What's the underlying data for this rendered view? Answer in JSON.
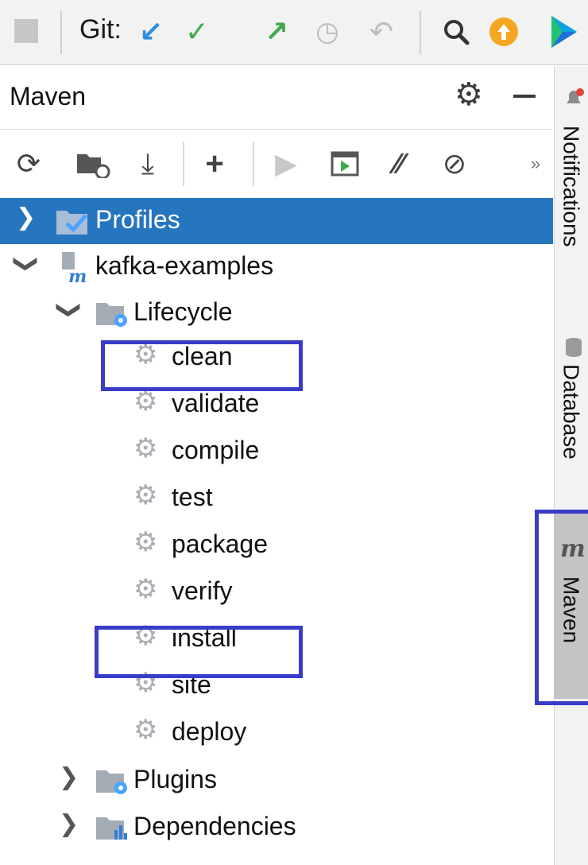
{
  "toolbar": {
    "git_label": "Git:",
    "icons": [
      "stop-icon",
      "update-project-icon",
      "commit-icon",
      "push-icon",
      "history-icon",
      "rollback-icon",
      "search-icon",
      "update-available-icon",
      "ide-logo-icon"
    ],
    "colors": {
      "update": "#2d8fe0",
      "commit": "#3fa84b",
      "push": "#3fa84b",
      "update_available": "#f5a623"
    }
  },
  "panel": {
    "title": "Maven",
    "toolbar_icons": [
      "reload-all-icon",
      "reload-folder-icon",
      "download-icon",
      "add-icon",
      "run-icon",
      "execute-goal-icon",
      "toggle-offline-icon",
      "skip-tests-icon",
      "more-icon"
    ]
  },
  "tree": {
    "profiles": "Profiles",
    "project": "kafka-examples",
    "lifecycle": "Lifecycle",
    "goals": [
      "clean",
      "validate",
      "compile",
      "test",
      "package",
      "verify",
      "install",
      "site",
      "deploy"
    ],
    "plugins": "Plugins",
    "dependencies": "Dependencies"
  },
  "right_stripe": {
    "tabs": [
      "Notifications",
      "Database",
      "Maven"
    ],
    "active_tab": "Maven"
  },
  "colors": {
    "selection": "#2675bf",
    "highlight_box": "#3a3cc8"
  }
}
